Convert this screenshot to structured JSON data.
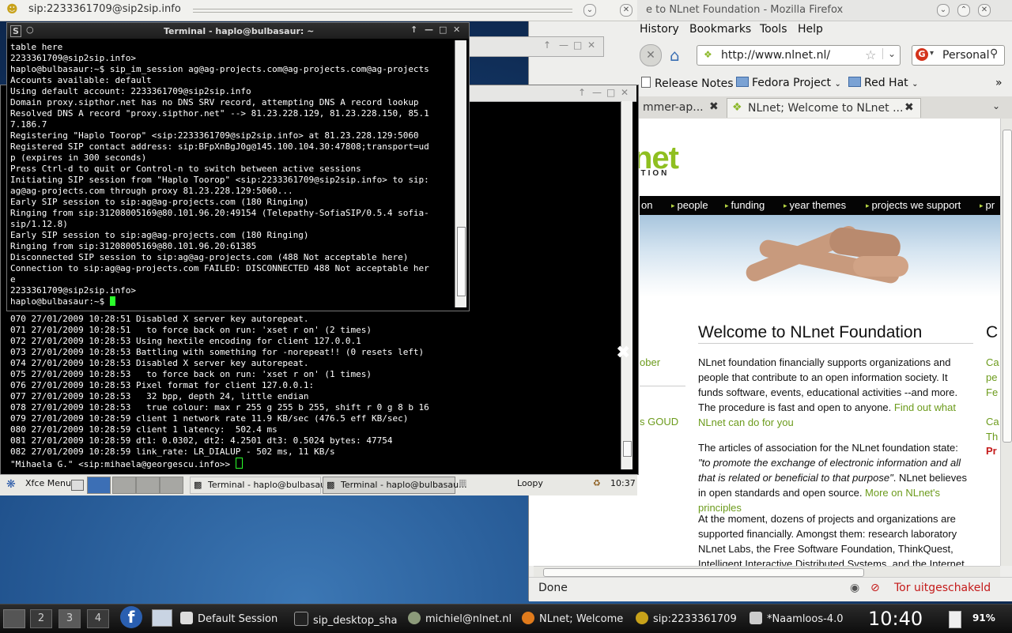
{
  "sip_window": {
    "title": "sip:2233361709@sip2sip.info"
  },
  "firefox": {
    "title": "e to NLnet Foundation - Mozilla Firefox",
    "menu": [
      "History",
      "Bookmarks",
      "Tools",
      "Help"
    ],
    "url": "http://www.nlnet.nl/",
    "search_placeholder": "Personal",
    "bookmarks": [
      "Release Notes",
      "Fedora Project",
      "Red Hat"
    ],
    "tabs": {
      "inactive": "mmer-ap...",
      "active": "NLnet; Welcome to NLnet ..."
    },
    "status": {
      "text": "Done",
      "tor": "Tor uitgeschakeld"
    },
    "page": {
      "logo": "net",
      "logo_sub": "ATION",
      "nav": [
        "on",
        "people",
        "funding",
        "year themes",
        "projects we support",
        "pr"
      ],
      "heading": "Welcome to NLnet Foundation",
      "p1": "NLnet foundation financially supports organizations and people that contribute to an open information society. It funds software, events, educational activities --and more. The procedure is fast and open to anyone. ",
      "p1_link": "Find out what NLnet can do for you",
      "p2_a": "The articles of association for the NLnet foundation state: ",
      "p2_quote": "\"to promote the exchange of electronic information and all that is related or beneficial to that purpose\"",
      "p2_b": ". NLnet believes in open standards and open source. ",
      "p2_link": "More on NLnet's principles",
      "p3": "At the moment, dozens of projects and organizations are supported financially. Amongst them: research laboratory NLnet Labs, the Free Software Foundation, ThinkQuest, Intelligent Interactive Distributed Systems, and the Internet",
      "left_links": [
        "ober",
        "s GOUD"
      ],
      "right_col": {
        "heading": "C",
        "l1": "Ca",
        "l2": "pe",
        "l3": "Fe",
        "l4": "Ca",
        "l5": "Th",
        "l6": "Pr"
      }
    }
  },
  "terminal1": {
    "title": "Terminal - haplo@bulbasaur: ~",
    "lines": [
      "table here",
      "2233361709@sip2sip.info>",
      "haplo@bulbasaur:~$ sip_im_session ag@ag-projects.com@ag-projects.com@ag-projects",
      "Accounts available: default",
      "Using default account: 2233361709@sip2sip.info",
      "Domain proxy.sipthor.net has no DNS SRV record, attempting DNS A record lookup",
      "Resolved DNS A record \"proxy.sipthor.net\" --> 81.23.228.129, 81.23.228.150, 85.1",
      "7.186.7",
      "Registering \"Haplo Toorop\" <sip:2233361709@sip2sip.info> at 81.23.228.129:5060",
      "Registered SIP contact address: sip:BFpXnBgJ0g@145.100.104.30:47808;transport=ud",
      "p (expires in 300 seconds)",
      "Press Ctrl-d to quit or Control-n to switch between active sessions",
      "Initiating SIP session from \"Haplo Toorop\" <sip:2233361709@sip2sip.info> to sip:",
      "ag@ag-projects.com through proxy 81.23.228.129:5060...",
      "Early SIP session to sip:ag@ag-projects.com (180 Ringing)",
      "Ringing from sip:31208005169@80.101.96.20:49154 (Telepathy-SofiaSIP/0.5.4 sofia-",
      "sip/1.12.8)",
      "Early SIP session to sip:ag@ag-projects.com (180 Ringing)",
      "Ringing from sip:31208005169@80.101.96.20:61385",
      "Disconnected SIP session to sip:ag@ag-projects.com (488 Not acceptable here)",
      "Connection to sip:ag@ag-projects.com FAILED: DISCONNECTED 488 Not acceptable her",
      "e",
      "2233361709@sip2sip.info>"
    ],
    "prompt": "haplo@bulbasaur:~$ "
  },
  "terminal2": {
    "lines": [
      "070 27/01/2009 10:28:51 Disabled X server key autorepeat.",
      "071 27/01/2009 10:28:51   to force back on run: 'xset r on' (2 times)",
      "072 27/01/2009 10:28:53 Using hextile encoding for client 127.0.0.1",
      "073 27/01/2009 10:28:53 Battling with something for -norepeat!! (0 resets left)",
      "074 27/01/2009 10:28:53 Disabled X server key autorepeat.",
      "075 27/01/2009 10:28:53   to force back on run: 'xset r on' (1 times)",
      "076 27/01/2009 10:28:53 Pixel format for client 127.0.0.1:",
      "077 27/01/2009 10:28:53   32 bpp, depth 24, little endian",
      "078 27/01/2009 10:28:53   true colour: max r 255 g 255 b 255, shift r 0 g 8 b 16",
      "079 27/01/2009 10:28:59 client 1 network rate 11.9 KB/sec (476.5 eff KB/sec)",
      "080 27/01/2009 10:28:59 client 1 latency:  502.4 ms",
      "081 27/01/2009 10:28:59 dt1: 0.0302, dt2: 4.2501 dt3: 0.5024 bytes: 47754",
      "082 27/01/2009 10:28:59 link_rate: LR_DIALUP - 502 ms, 11 KB/s"
    ],
    "prompt": "\"Mihaela G.\" <sip:mihaela@georgescu.info>> "
  },
  "xfce_panel": {
    "menu": "Xfce Menu",
    "task1": "Terminal - haplo@bulbasau...",
    "task2": "Terminal - haplo@bulbasau...",
    "loopy": "Loopy",
    "time": "10:37"
  },
  "bottom_panel": {
    "workspaces": [
      "2",
      "3",
      "4"
    ],
    "tasks": [
      "Default Session",
      "sip_desktop_sha",
      "michiel@nlnet.nl",
      "NLnet; Welcome",
      "sip:2233361709",
      "*Naamloos-4.0"
    ],
    "clock": "10:40",
    "battery": "91%"
  }
}
